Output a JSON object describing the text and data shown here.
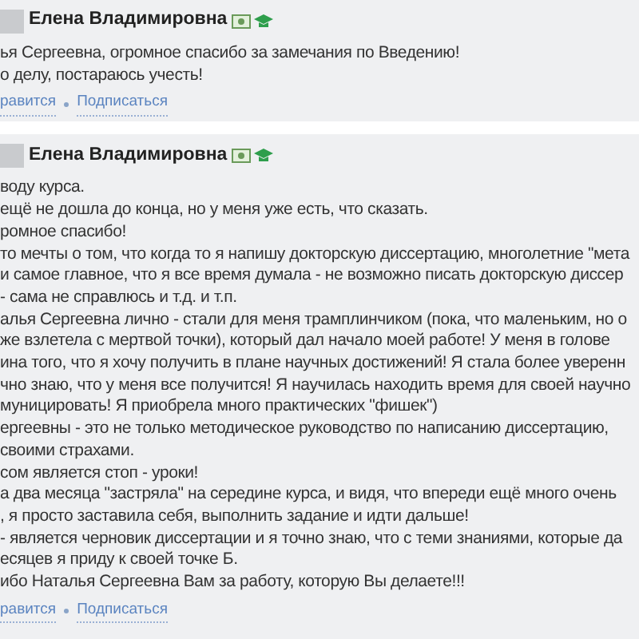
{
  "comments": [
    {
      "author": "Елена Владимировна",
      "lines": [
        "ья Сергеевна, огромное спасибо за замечания по Введению!",
        "о делу, постараюсь учесть!"
      ],
      "links": [
        "равится",
        "Подписаться"
      ]
    },
    {
      "author": "Елена Владимировна",
      "lines": [
        "воду курса.",
        "ещё не дошла до конца, но у меня уже есть, что сказать.",
        "ромное спасибо!",
        "то мечты о том, что когда то я напишу докторскую диссертацию, многолетние \"мета",
        "и самое главное, что я все время думала - не возможно писать докторскую диссер",
        "- сама не справлюсь и т.д. и т.п.",
        "алья Сергеевна лично - стали для меня трамплинчиком (пока, что маленьким, но о",
        "же взлетела с мертвой точки), который дал начало моей работе! У меня в голове",
        "ина того, что я хочу получить в плане научных достижений! Я стала более уверенн",
        "чно знаю, что у меня все получится! Я научилась находить время для своей научно",
        "муницировать! Я приобрела много практических \"фишек\")",
        "ергеевны - это не только методическое руководство по написанию диссертацию,",
        "своими страхами.",
        "сом является стоп - уроки!",
        "а два месяца \"застряла\" на середине курса, и видя, что впереди ещё много очень",
        ", я просто заставила себя, выполнить задание и идти дальше!",
        "- является черновик диссертации и я точно знаю, что с теми знаниями, которые да",
        "есяцев я приду к своей точке Б.",
        "ибо Наталья Сергеевна Вам за работу, которую Вы делаете!!!"
      ],
      "links": [
        "равится",
        "Подписаться"
      ]
    }
  ]
}
